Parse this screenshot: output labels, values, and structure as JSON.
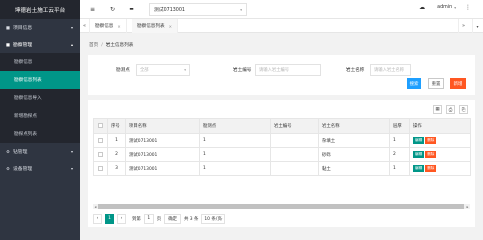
{
  "app": {
    "title": "坤德岩土施工云平台"
  },
  "sidebar": {
    "menus": [
      {
        "label": "项目信息",
        "icon": "square-icon",
        "arrow": "▾"
      },
      {
        "label": "勘察管理",
        "icon": "square-icon",
        "arrow": "▴"
      },
      {
        "label": "钻管理",
        "icon": "gear-icon",
        "arrow": "▾"
      },
      {
        "label": "设备管理",
        "icon": "gear-icon",
        "arrow": "▾"
      }
    ],
    "submenu": [
      {
        "label": "勘察信息"
      },
      {
        "label": "勘察信息列表"
      },
      {
        "label": "勘察信息导入"
      },
      {
        "label": "新增勘探点"
      },
      {
        "label": "勘探点列表"
      }
    ]
  },
  "header": {
    "menu_icon": "≡",
    "refresh_icon": "↻",
    "monitor_icon": "▬",
    "company": "测试0713001",
    "company_caret": "▾",
    "cloud_icon": "☁",
    "user": "admin",
    "user_caret": "▾",
    "more_icon": "⋮"
  },
  "tabs": {
    "prev": "«",
    "next": "»",
    "items": [
      {
        "label": "勘察信息",
        "close": "✕"
      },
      {
        "label": "勘察信息列表",
        "close": "✕"
      }
    ]
  },
  "breadcrumb": {
    "home": "首页",
    "sep": "/",
    "current": "岩土信息列表"
  },
  "search": {
    "f1_label": "勘测点",
    "f1_value": "全部",
    "f1_caret": "▾",
    "f2_label": "岩土编号",
    "f2_placeholder": "请输入岩土编号",
    "f3_label": "岩土名称",
    "f3_placeholder": "请输入岩土名称",
    "search_btn": "搜索",
    "reset_btn": "重置",
    "add_btn": "新增"
  },
  "table": {
    "tool_icons": [
      "▦",
      "⎙",
      "⎘"
    ],
    "columns": [
      "序号",
      "项目名称",
      "勘测点",
      "岩土编号",
      "岩土名称",
      "层厚",
      "操作"
    ],
    "rows": [
      {
        "no": "1",
        "project": "测试0713001",
        "point": "1",
        "code": "",
        "name": "杂填土",
        "thickness": "1"
      },
      {
        "no": "2",
        "project": "测试0713001",
        "point": "1",
        "code": "",
        "name": "砂砾",
        "thickness": "2"
      },
      {
        "no": "3",
        "project": "测试0713001",
        "point": "1",
        "code": "",
        "name": "黏土",
        "thickness": "1"
      }
    ],
    "edit_label": "编辑",
    "delete_label": "删除"
  },
  "scrollbar": {
    "left_arrow": "◂",
    "right_arrow": "▸"
  },
  "pager": {
    "prev": "‹",
    "current_page": "1",
    "next": "›",
    "goto_prefix": "到第",
    "goto_value": "1",
    "goto_suffix": "页",
    "confirm": "确定",
    "total": "共 3 条",
    "page_size": "10 条/页",
    "page_size_caret": "▾"
  }
}
